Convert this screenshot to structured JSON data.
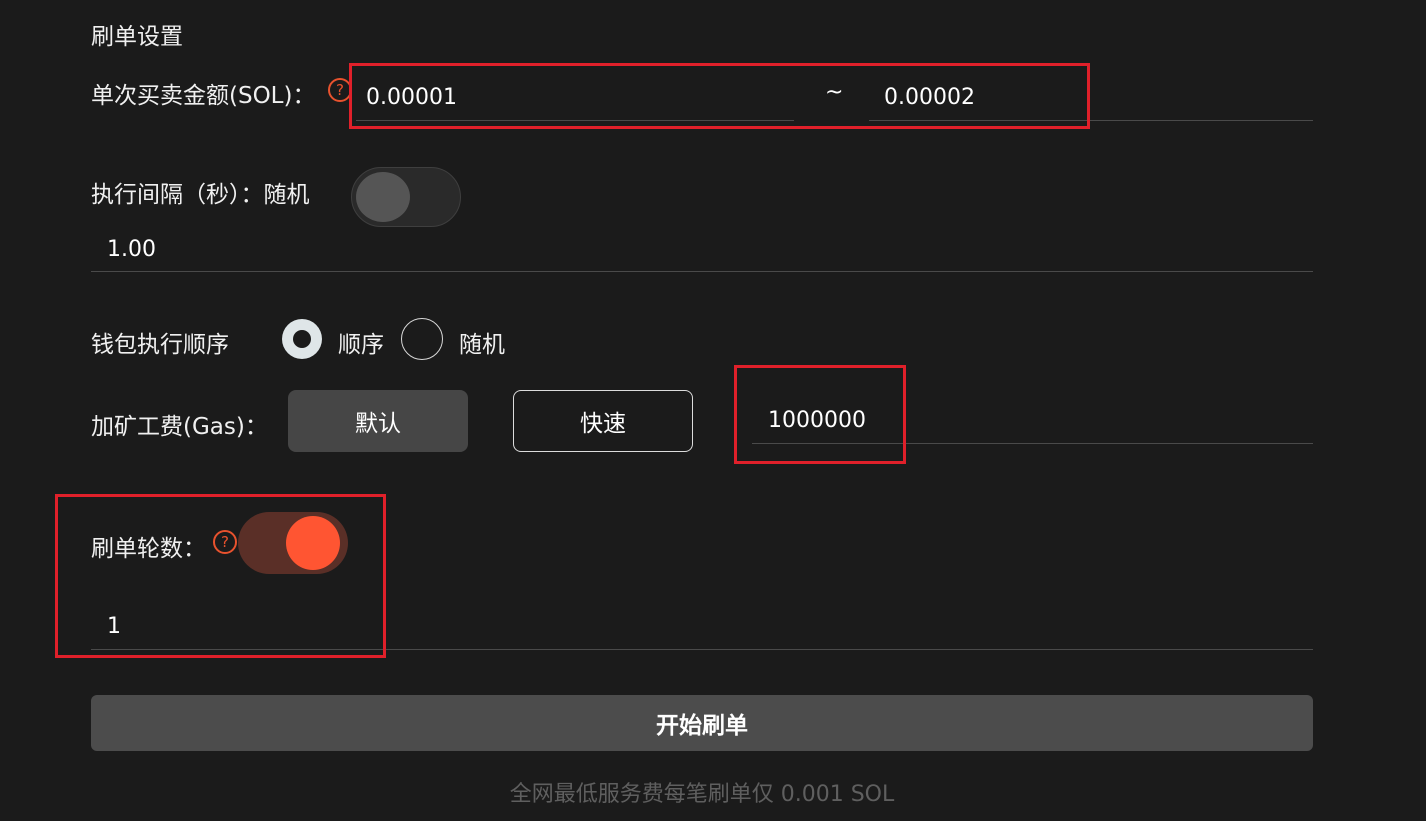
{
  "section_title": "刷单设置",
  "amount": {
    "label": "单次买卖金额(SOL)：",
    "help_icon": "?",
    "min_value": "0.00001",
    "separator": "~",
    "max_value": "0.00002"
  },
  "interval": {
    "label": "执行间隔（秒）：随机",
    "random_enabled": false,
    "value": "1.00"
  },
  "wallet_order": {
    "label": "钱包执行顺序",
    "options": [
      {
        "label": "顺序",
        "selected": true
      },
      {
        "label": "随机",
        "selected": false
      }
    ]
  },
  "gas": {
    "label": "加矿工费(Gas)：",
    "default_button": "默认",
    "fast_button": "快速",
    "value": "1000000"
  },
  "rounds": {
    "label": "刷单轮数：",
    "help_icon": "?",
    "enabled": true,
    "value": "1"
  },
  "start_button": "开始刷单",
  "footnote": "全网最低服务费每笔刷单仅 0.001 SOL",
  "colors": {
    "background": "#1b1b1b",
    "accent": "#ff5532",
    "highlight_box": "#e0202a"
  }
}
